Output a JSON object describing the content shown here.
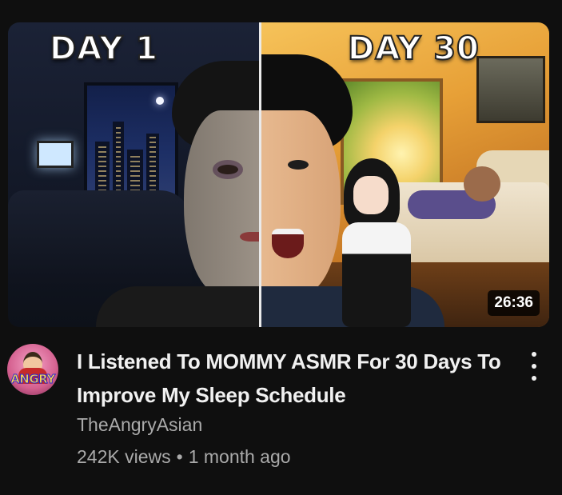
{
  "thumbnail": {
    "left_label": "DAY 1",
    "right_label": "DAY 30",
    "duration": "26:36"
  },
  "avatar": {
    "text": "ANGRY"
  },
  "video": {
    "title": "I Listened To MOMMY ASMR For 30 Days To Improve My Sleep Schedule",
    "channel": "TheAngryAsian",
    "views": "242K views",
    "separator": "•",
    "age": "1 month ago"
  },
  "icons": {
    "menu": "more-vert-icon"
  },
  "colors": {
    "background": "#0f0f0f",
    "title": "#f1f1f1",
    "meta": "#aaaaaa"
  }
}
